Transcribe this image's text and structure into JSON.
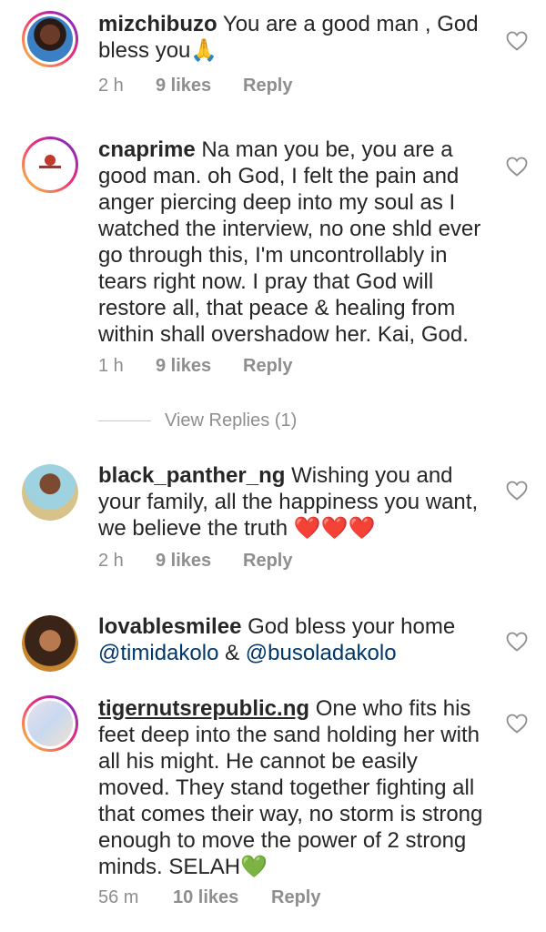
{
  "comments": [
    {
      "username": "mizchibuzo",
      "text": "You are a good man , God bless you🙏",
      "time": "2 h",
      "likes": "9 likes",
      "reply": "Reply"
    },
    {
      "username": "cnaprime",
      "text": "Na man you be, you are a good man. oh God, I felt the pain and anger piercing deep into my soul as I watched the interview, no one shld ever go through this, I'm uncontrollably in tears right now. I pray that God will restore all, that peace & healing from within shall overshadow her. Kai, God.",
      "time": "1 h",
      "likes": "9 likes",
      "reply": "Reply",
      "view_replies": "View Replies (1)"
    },
    {
      "username": "black_panther_ng",
      "text": "Wishing you and your family, all the happiness you want, we believe the truth ❤️❤️❤️",
      "time": "2 h",
      "likes": "9 likes",
      "reply": "Reply"
    },
    {
      "username": "lovablesmilee",
      "text": "God bless your home",
      "mention1": "@timidakolo",
      "and": " & ",
      "mention2": "@busoladakolo"
    },
    {
      "username": "tigernutsrepublic.ng",
      "text": "One who fits his feet deep into the sand holding her with all his might. He cannot be easily moved. They stand together fighting all that comes their way, no storm is strong enough to move the power of 2 strong minds. SELAH💚",
      "time": "56 m",
      "likes": "10 likes",
      "reply": "Reply"
    }
  ],
  "icons": {
    "like": "heart-outline-icon"
  }
}
